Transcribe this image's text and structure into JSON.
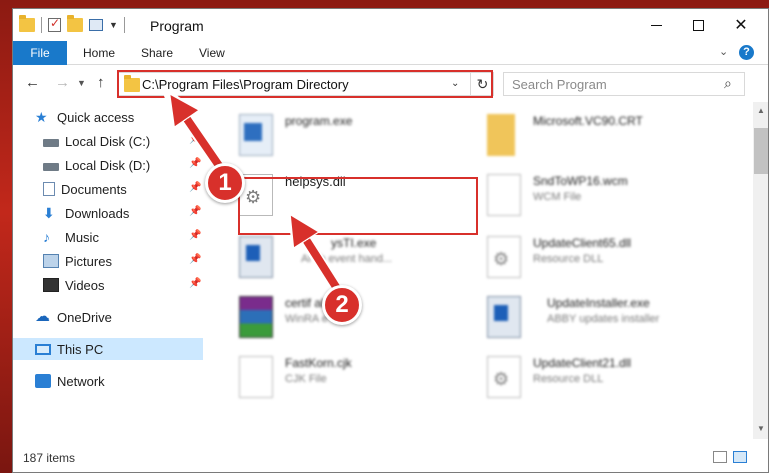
{
  "window": {
    "title": "Program",
    "ribbon_tabs": [
      "File",
      "Home",
      "Share",
      "View"
    ]
  },
  "address": {
    "path": "C:\\Program Files\\Program Directory"
  },
  "search": {
    "placeholder": "Search Program"
  },
  "sidebar": {
    "items": [
      {
        "label": "Quick access",
        "icon": "star-icon"
      },
      {
        "label": "Local Disk (C:)",
        "icon": "disk-icon"
      },
      {
        "label": "Local Disk (D:)",
        "icon": "disk-icon"
      },
      {
        "label": "Documents",
        "icon": "documents-icon"
      },
      {
        "label": "Downloads",
        "icon": "downloads-icon"
      },
      {
        "label": "Music",
        "icon": "music-icon"
      },
      {
        "label": "Pictures",
        "icon": "pictures-icon"
      },
      {
        "label": "Videos",
        "icon": "videos-icon"
      },
      {
        "label": "OneDrive",
        "icon": "onedrive-icon"
      },
      {
        "label": "This PC",
        "icon": "this-pc-icon"
      },
      {
        "label": "Network",
        "icon": "network-icon"
      }
    ]
  },
  "files": [
    {
      "name": "program.exe",
      "desc": ""
    },
    {
      "name": "Microsoft.VC90.CRT",
      "desc": ""
    },
    {
      "name": "helpsys.dll",
      "desc": ""
    },
    {
      "name": "SndToWP16.wcm",
      "desc": "WCM File"
    },
    {
      "name": "ysTI.exe",
      "desc": "Al  ch event hand..."
    },
    {
      "name": "UpdateClient65.dll",
      "desc": "Resource DLL"
    },
    {
      "name": "certif   ab",
      "desc": "WinRA   e"
    },
    {
      "name": "UpdateInstaller.exe",
      "desc": "ABBY updates installer"
    },
    {
      "name": "FastKorn.cjk",
      "desc": "CJK File"
    },
    {
      "name": "UpdateClient21.dll",
      "desc": "Resource DLL"
    }
  ],
  "status": {
    "item_count": "187 items"
  },
  "annotations": {
    "step1": "1",
    "step2": "2",
    "color": "#d8302b"
  }
}
